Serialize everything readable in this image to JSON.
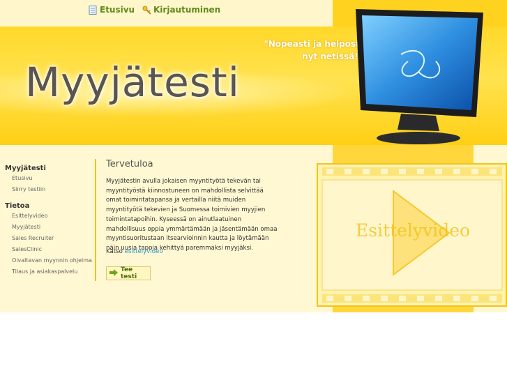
{
  "nav": {
    "home_label": "Etusivu",
    "login_label": "Kirjautuminen"
  },
  "header": {
    "logo_text": "Myyjätesti",
    "slogan_line1": "\"Nopeasti ja helposti",
    "slogan_line2": "nyt netissä!\""
  },
  "sidebar": {
    "section1_title": "Myyjätesti",
    "section1_items": [
      "Etusivu",
      "Siirry testiin"
    ],
    "section2_title": "Tietoa",
    "section2_items": [
      "Esittelyvideo",
      "Myyjätesti",
      "Sales Recruiter",
      "SalesClinic",
      "Oivaltavan myynnin ohjelma",
      "Tilaus ja asiakaspalvelu"
    ]
  },
  "main": {
    "title": "Tervetuloa",
    "body": "Myyjätestin avulla jokaisen myyntityötä tekevän tai myyntityöstä kiinnostuneen on mahdollista selvittää omat toimintatapansa ja vertailla niitä muiden myyntityötä tekevien ja Suomessa toimivien myyjien toimintatapoihin. Kyseessä on ainutlaatuinen mahdollisuus oppia ymmärtämään ja jäsentämään omaa myyntisuoritustaan itsearvioinnin kautta ja löytämään näin uusia tapoja kehittyä paremmaksi myyjäksi.",
    "link_prefix": "Katso ",
    "link_text": "esittelyvideo",
    "button_label": "Tee testi"
  },
  "video": {
    "label": "Esittelyvideo"
  },
  "colors": {
    "accent_yellow": "#ffd21f",
    "link_blue": "#2a9bd1",
    "nav_green": "#5f8a1a"
  }
}
